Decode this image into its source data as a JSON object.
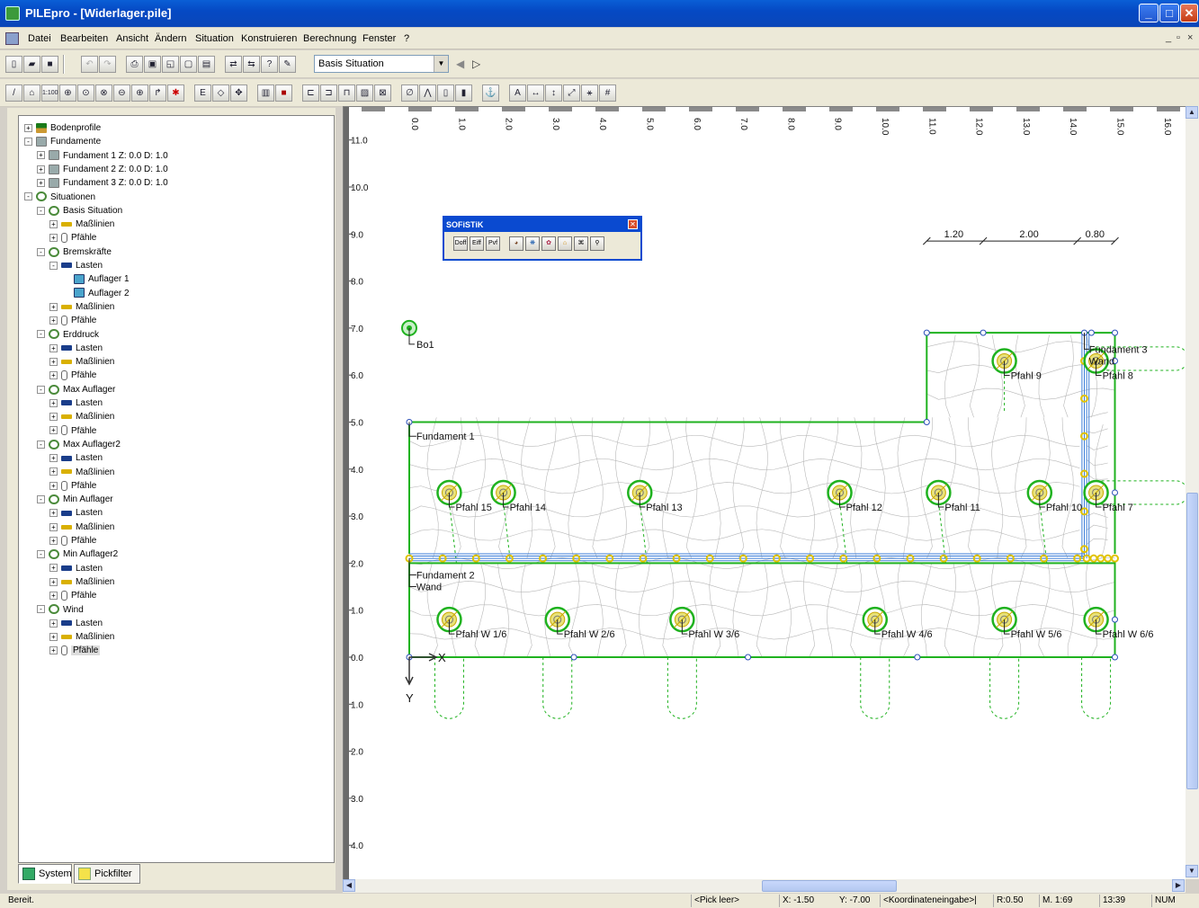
{
  "window": {
    "title": "PILEpro - [Widerlager.pile]"
  },
  "menu": [
    "Datei",
    "Bearbeiten",
    "Ansicht",
    "Ändern",
    "Situation",
    "Konstruieren",
    "Berechnung",
    "Fenster",
    "?"
  ],
  "toolbar": {
    "situation_combo": "Basis Situation"
  },
  "tree": [
    {
      "label": "Bodenprofile",
      "level": 0,
      "pm": "+",
      "icon": "ic-b"
    },
    {
      "label": "Fundamente",
      "level": 0,
      "pm": "-",
      "icon": "ic-f"
    },
    {
      "label": "Fundament 1 Z: 0.0 D:  1.0",
      "level": 1,
      "pm": "+",
      "icon": "ic-f"
    },
    {
      "label": "Fundament 2 Z: 0.0 D:  1.0",
      "level": 1,
      "pm": "+",
      "icon": "ic-f"
    },
    {
      "label": "Fundament 3 Z: 0.0 D:  1.0",
      "level": 1,
      "pm": "+",
      "icon": "ic-f"
    },
    {
      "label": "Situationen",
      "level": 0,
      "pm": "-",
      "icon": "ic-s"
    },
    {
      "label": "Basis Situation",
      "level": 1,
      "pm": "-",
      "icon": "ic-s"
    },
    {
      "label": "Maßlinien",
      "level": 2,
      "pm": "+",
      "icon": "ic-m"
    },
    {
      "label": "Pfähle",
      "level": 2,
      "pm": "+",
      "icon": "ic-p"
    },
    {
      "label": "Bremskräfte",
      "level": 1,
      "pm": "-",
      "icon": "ic-s"
    },
    {
      "label": "Lasten",
      "level": 2,
      "pm": "-",
      "icon": "ic-l"
    },
    {
      "label": "Auflager 1",
      "level": 3,
      "pm": "",
      "icon": "ic-a"
    },
    {
      "label": "Auflager 2",
      "level": 3,
      "pm": "",
      "icon": "ic-a"
    },
    {
      "label": "Maßlinien",
      "level": 2,
      "pm": "+",
      "icon": "ic-m"
    },
    {
      "label": "Pfähle",
      "level": 2,
      "pm": "+",
      "icon": "ic-p"
    },
    {
      "label": "Erddruck",
      "level": 1,
      "pm": "-",
      "icon": "ic-s"
    },
    {
      "label": "Lasten",
      "level": 2,
      "pm": "+",
      "icon": "ic-l"
    },
    {
      "label": "Maßlinien",
      "level": 2,
      "pm": "+",
      "icon": "ic-m"
    },
    {
      "label": "Pfähle",
      "level": 2,
      "pm": "+",
      "icon": "ic-p"
    },
    {
      "label": "Max Auflager",
      "level": 1,
      "pm": "-",
      "icon": "ic-s"
    },
    {
      "label": "Lasten",
      "level": 2,
      "pm": "+",
      "icon": "ic-l"
    },
    {
      "label": "Maßlinien",
      "level": 2,
      "pm": "+",
      "icon": "ic-m"
    },
    {
      "label": "Pfähle",
      "level": 2,
      "pm": "+",
      "icon": "ic-p"
    },
    {
      "label": "Max Auflager2",
      "level": 1,
      "pm": "-",
      "icon": "ic-s"
    },
    {
      "label": "Lasten",
      "level": 2,
      "pm": "+",
      "icon": "ic-l"
    },
    {
      "label": "Maßlinien",
      "level": 2,
      "pm": "+",
      "icon": "ic-m"
    },
    {
      "label": "Pfähle",
      "level": 2,
      "pm": "+",
      "icon": "ic-p"
    },
    {
      "label": "Min Auflager",
      "level": 1,
      "pm": "-",
      "icon": "ic-s"
    },
    {
      "label": "Lasten",
      "level": 2,
      "pm": "+",
      "icon": "ic-l"
    },
    {
      "label": "Maßlinien",
      "level": 2,
      "pm": "+",
      "icon": "ic-m"
    },
    {
      "label": "Pfähle",
      "level": 2,
      "pm": "+",
      "icon": "ic-p"
    },
    {
      "label": "Min Auflager2",
      "level": 1,
      "pm": "-",
      "icon": "ic-s"
    },
    {
      "label": "Lasten",
      "level": 2,
      "pm": "+",
      "icon": "ic-l"
    },
    {
      "label": "Maßlinien",
      "level": 2,
      "pm": "+",
      "icon": "ic-m"
    },
    {
      "label": "Pfähle",
      "level": 2,
      "pm": "+",
      "icon": "ic-p"
    },
    {
      "label": "Wind",
      "level": 1,
      "pm": "-",
      "icon": "ic-s"
    },
    {
      "label": "Lasten",
      "level": 2,
      "pm": "+",
      "icon": "ic-l"
    },
    {
      "label": "Maßlinien",
      "level": 2,
      "pm": "+",
      "icon": "ic-m"
    },
    {
      "label": "Pfähle",
      "level": 2,
      "pm": "+",
      "icon": "ic-p",
      "selected": true
    }
  ],
  "tabs": {
    "system": "System",
    "pickfilter": "Pickfilter"
  },
  "sofistik": {
    "title": "SOFiSTiK",
    "buttons": [
      "Doff",
      "Eiff",
      "Pvf",
      "",
      "",
      "",
      "",
      "",
      ""
    ]
  },
  "drawing": {
    "x_ticks": [
      "0.0",
      "1.0",
      "2.0",
      "3.0",
      "4.0",
      "5.0",
      "6.0",
      "7.0",
      "8.0",
      "9.0",
      "10.0",
      "11.0",
      "12.0",
      "13.0",
      "14.0",
      "15.0",
      "16.0"
    ],
    "y_ticks": [
      "11.0",
      "10.0",
      "9.0",
      "8.0",
      "7.0",
      "6.0",
      "5.0",
      "4.0",
      "3.0",
      "2.0",
      "1.0",
      "0.0",
      "1.0",
      "2.0",
      "3.0",
      "4.0"
    ],
    "dimensions": [
      "1.20",
      "2.00",
      "0.80"
    ],
    "labels": {
      "bo": "Bo1",
      "f1": "Fundament 1",
      "f2": "Fundament 2",
      "wand": "Wand",
      "f3": "Fundament 3",
      "wand3": "Wand",
      "axis_x": "X",
      "axis_y": "Y"
    },
    "piles": [
      {
        "x": 0.85,
        "y": 3.5,
        "label": "Pfahl 15"
      },
      {
        "x": 2.0,
        "y": 3.5,
        "label": "Pfahl 14"
      },
      {
        "x": 4.9,
        "y": 3.5,
        "label": "Pfahl 13"
      },
      {
        "x": 9.15,
        "y": 3.5,
        "label": "Pfahl 12"
      },
      {
        "x": 11.25,
        "y": 3.5,
        "label": "Pfahl 11"
      },
      {
        "x": 13.4,
        "y": 3.5,
        "label": "Pfahl 10"
      },
      {
        "x": 14.6,
        "y": 3.5,
        "label": "Pfahl 7"
      },
      {
        "x": 12.65,
        "y": 6.3,
        "label": "Pfahl 9"
      },
      {
        "x": 14.6,
        "y": 6.3,
        "label": "Pfahl 8"
      },
      {
        "x": 0.85,
        "y": 0.8,
        "label": "Pfahl W 1/6"
      },
      {
        "x": 3.15,
        "y": 0.8,
        "label": "Pfahl W 2/6"
      },
      {
        "x": 5.8,
        "y": 0.8,
        "label": "Pfahl W 3/6"
      },
      {
        "x": 9.9,
        "y": 0.8,
        "label": "Pfahl W 4/6"
      },
      {
        "x": 12.65,
        "y": 0.8,
        "label": "Pfahl W 5/6"
      },
      {
        "x": 14.6,
        "y": 0.8,
        "label": "Pfahl W 6/6"
      }
    ]
  },
  "status": {
    "ready": "Bereit.",
    "pick": "<Pick leer>",
    "x": "X: -1.50",
    "y": "Y: -7.00",
    "coord": "<Koordinateneingabe>|",
    "r": "R:0.50",
    "m": "M. 1:69",
    "time": "13:39",
    "num": "NUM"
  },
  "colors": {
    "green": "#1fb21f",
    "wall": "#3c7ed8",
    "mesh": "#b8b8b8",
    "yellow": "#e0c200",
    "node": "#2b4fb8"
  }
}
